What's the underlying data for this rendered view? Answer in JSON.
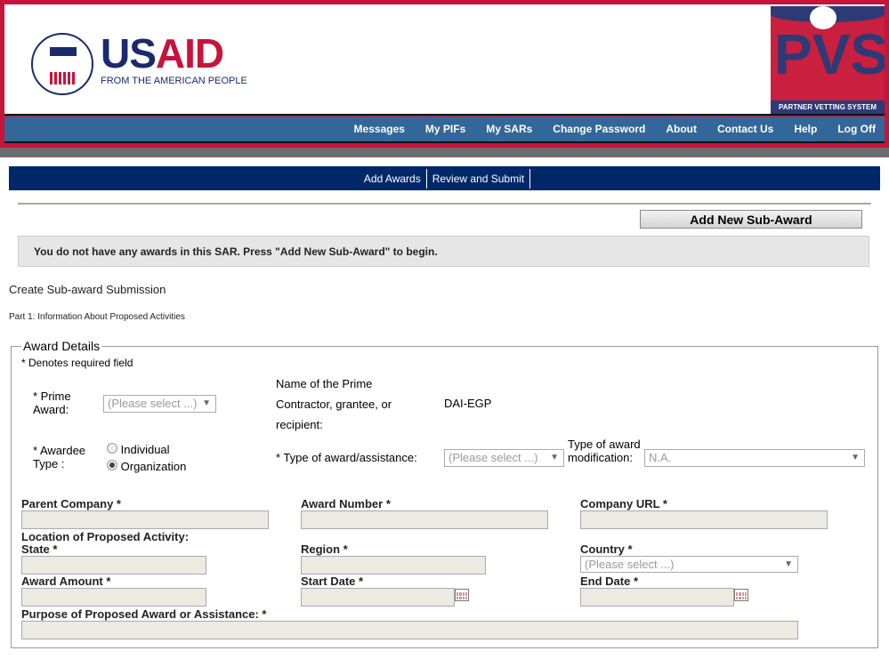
{
  "header": {
    "usaid_logo": "USAID FROM THE AMERICAN PEOPLE",
    "pvs_logo": "PVS PARTNER VETTING SYSTEM",
    "brand_colors": {
      "crimson": "#c8133b",
      "navy": "#002868",
      "nav_blue": "#336699"
    }
  },
  "nav": [
    "Messages",
    "My PIFs",
    "My SARs",
    "Change Password",
    "About",
    "Contact Us",
    "Help",
    "Log Off"
  ],
  "subnav": [
    "Add Awards",
    "Review and Submit"
  ],
  "add_button": "Add New Sub-Award",
  "message": "You do not have any awards in this SAR. Press \"Add New Sub-Award\" to begin.",
  "title": "Create Sub-award Submission",
  "part": "Part 1: Information About Proposed Activities",
  "form": {
    "legend": "Award Details",
    "required_note": "* Denotes required field",
    "prime_award_label": "* Prime Award:",
    "prime_award_value": "(Please select ...)",
    "prime_name_label": "Name of the Prime Contractor, grantee, or recipient:",
    "prime_name_value": "DAI-EGP",
    "awardee_type_label": "* Awardee Type :",
    "awardee_options": [
      "Individual",
      "Organization"
    ],
    "awardee_selected": "Organization",
    "award_type_label": "* Type of award/assistance:",
    "award_type_value": "(Please select ...)",
    "modification_label": "Type of award modification:",
    "modification_value": "N.A.",
    "parent_company": "Parent Company *",
    "award_number": "Award Number *",
    "company_url": "Company URL *",
    "location_heading": "Location of Proposed Activity:",
    "state": "State *",
    "region": "Region *",
    "country": "Country *",
    "country_value": "(Please select ...)",
    "award_amount": "Award Amount *",
    "start_date": "Start Date *",
    "end_date": "End Date *",
    "purpose": "Purpose of Proposed Award or Assistance: *"
  }
}
